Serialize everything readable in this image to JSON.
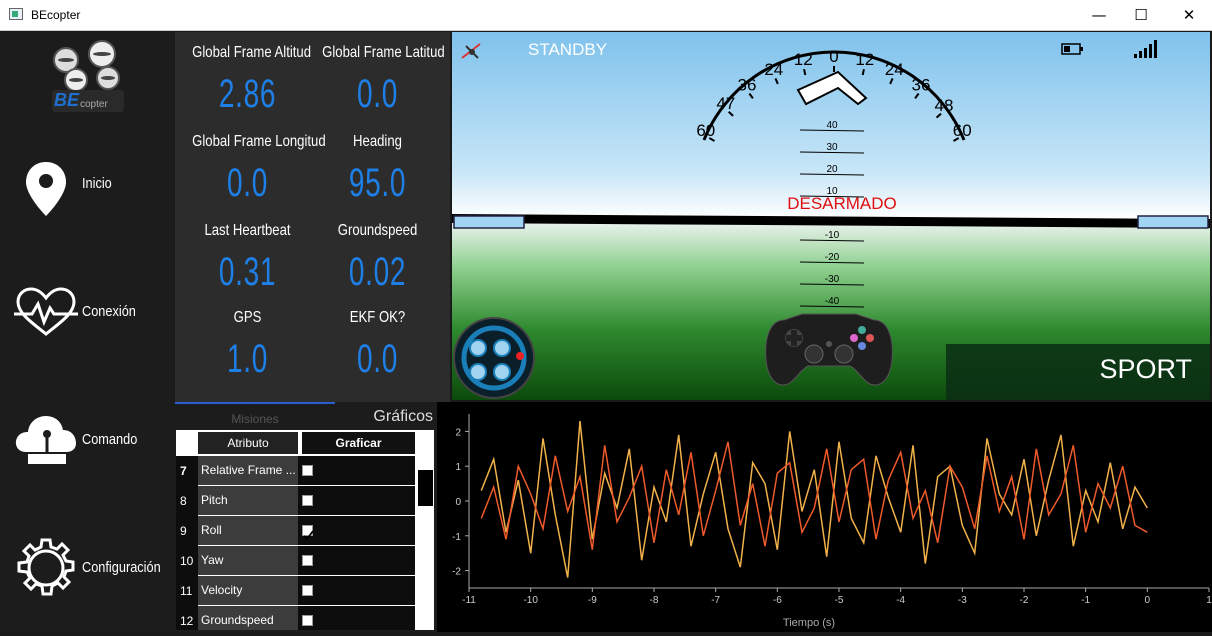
{
  "window": {
    "title": "BEcopter",
    "minimize": "—",
    "maximize": "☐",
    "close": "✕"
  },
  "logo": {
    "text_be": "BE",
    "text_rest": "copter"
  },
  "sidebar": {
    "items": [
      {
        "label": "Inicio",
        "icon": "location-pin-icon"
      },
      {
        "label": "Conexión",
        "icon": "heartbeat-icon"
      },
      {
        "label": "Comando",
        "icon": "cloud-joystick-icon"
      },
      {
        "label": "Configuración",
        "icon": "gear-icon"
      }
    ]
  },
  "telemetry": {
    "fields": [
      {
        "label": "Global Frame Altitud",
        "value": "2.86"
      },
      {
        "label": "Global Frame Latitud",
        "value": "0.0"
      },
      {
        "label": "Global Frame Longitud",
        "value": "0.0"
      },
      {
        "label": "Heading",
        "value": "95.0"
      },
      {
        "label": "Last Heartbeat",
        "value": "0.31"
      },
      {
        "label": "Groundspeed",
        "value": "0.02"
      },
      {
        "label": "GPS",
        "value": "1.0"
      },
      {
        "label": "EKF OK?",
        "value": "0.0"
      }
    ]
  },
  "hud": {
    "status_left": "STANDBY",
    "armed_status": "DESARMADO",
    "mode": "SPORT",
    "roll_scale": [
      "60",
      "47",
      "36",
      "24",
      "12",
      "0",
      "12",
      "24",
      "36",
      "48",
      "60"
    ],
    "pitch_scale": [
      "40",
      "30",
      "20",
      "10",
      "-10",
      "-20",
      "-30",
      "-40"
    ],
    "colors": {
      "sky": "#8ec9ee",
      "ground": "#2e8a2e",
      "warning": "#e01010",
      "accent": "#1e7fe6"
    }
  },
  "tabs": {
    "missions": "Misiones",
    "charts": "Gráficos"
  },
  "table": {
    "headers": {
      "attribute": "Atributo",
      "plot": "Graficar"
    },
    "rows": [
      {
        "idx": "7",
        "name": "Relative Frame ...",
        "checked": false
      },
      {
        "idx": "8",
        "name": "Pitch",
        "checked": false
      },
      {
        "idx": "9",
        "name": "Roll",
        "checked": true
      },
      {
        "idx": "10",
        "name": "Yaw",
        "checked": false
      },
      {
        "idx": "11",
        "name": "Velocity",
        "checked": false
      },
      {
        "idx": "12",
        "name": "Groundspeed",
        "checked": false
      }
    ]
  },
  "chart_data": {
    "type": "line",
    "xlabel": "Tiempo (s)",
    "ylabel": "",
    "xlim": [
      -11,
      1
    ],
    "ylim": [
      -2.5,
      2.5
    ],
    "x_ticks": [
      "-11",
      "-10",
      "-9",
      "-8",
      "-7",
      "-6",
      "-5",
      "-4",
      "-3",
      "-2",
      "-1",
      "0",
      "1"
    ],
    "y_ticks": [
      "2",
      "1",
      "0",
      "-1",
      "-2"
    ],
    "grid": false,
    "series": [
      {
        "color": "#f2b24a",
        "x": [
          -10.8,
          -10.6,
          -10.4,
          -10.2,
          -10.0,
          -9.8,
          -9.6,
          -9.4,
          -9.2,
          -9.0,
          -8.8,
          -8.6,
          -8.4,
          -8.2,
          -8.0,
          -7.8,
          -7.6,
          -7.4,
          -7.2,
          -7.0,
          -6.8,
          -6.6,
          -6.4,
          -6.2,
          -6.0,
          -5.8,
          -5.6,
          -5.4,
          -5.2,
          -5.0,
          -4.8,
          -4.6,
          -4.4,
          -4.2,
          -4.0,
          -3.8,
          -3.6,
          -3.4,
          -3.2,
          -3.0,
          -2.8,
          -2.6,
          -2.4,
          -2.2,
          -2.0,
          -1.8,
          -1.6,
          -1.4,
          -1.2,
          -1.0,
          -0.8,
          -0.6,
          -0.4,
          -0.2,
          0.0
        ],
        "values": [
          0.3,
          1.2,
          -0.9,
          0.6,
          -1.5,
          1.8,
          -0.4,
          -2.2,
          2.3,
          -1.1,
          0.8,
          -0.2,
          1.5,
          -1.7,
          0.4,
          -0.6,
          1.9,
          -1.3,
          0.2,
          1.4,
          -0.8,
          -1.9,
          1.1,
          0.5,
          -1.4,
          2.0,
          -0.3,
          0.9,
          -1.6,
          1.7,
          -0.5,
          -1.2,
          1.3,
          0.1,
          -0.9,
          1.6,
          -1.8,
          0.7,
          1.0,
          -0.7,
          -1.5,
          1.8,
          0.2,
          -0.4,
          1.2,
          -1.0,
          0.6,
          1.9,
          -1.3,
          0.3,
          -0.6,
          1.1,
          -0.8,
          0.4,
          -0.2
        ]
      },
      {
        "color": "#ee5a2a",
        "x": [
          -10.8,
          -10.6,
          -10.4,
          -10.2,
          -10.0,
          -9.8,
          -9.6,
          -9.4,
          -9.2,
          -9.0,
          -8.8,
          -8.6,
          -8.4,
          -8.2,
          -8.0,
          -7.8,
          -7.6,
          -7.4,
          -7.2,
          -7.0,
          -6.8,
          -6.6,
          -6.4,
          -6.2,
          -6.0,
          -5.8,
          -5.6,
          -5.4,
          -5.2,
          -5.0,
          -4.8,
          -4.6,
          -4.4,
          -4.2,
          -4.0,
          -3.8,
          -3.6,
          -3.4,
          -3.2,
          -3.0,
          -2.8,
          -2.6,
          -2.4,
          -2.2,
          -2.0,
          -1.8,
          -1.6,
          -1.4,
          -1.2,
          -1.0,
          -0.8,
          -0.6,
          -0.4,
          -0.2,
          0.0
        ],
        "values": [
          -0.5,
          0.4,
          -1.1,
          1.0,
          0.2,
          -0.8,
          1.3,
          -0.3,
          0.7,
          -1.4,
          1.6,
          -0.6,
          0.1,
          1.0,
          -1.2,
          0.9,
          -0.4,
          1.4,
          -1.0,
          0.3,
          1.7,
          -0.7,
          0.5,
          -1.3,
          0.8,
          1.1,
          -0.9,
          -0.2,
          1.5,
          -0.6,
          0.9,
          1.2,
          -1.1,
          0.6,
          1.4,
          -0.5,
          0.3,
          -1.2,
          1.0,
          0.4,
          -0.8,
          1.3,
          -0.3,
          0.7,
          -1.1,
          1.5,
          -0.4,
          0.2,
          1.6,
          -0.9,
          0.5,
          -0.2,
          1.0,
          -0.7,
          -0.9
        ]
      }
    ]
  }
}
